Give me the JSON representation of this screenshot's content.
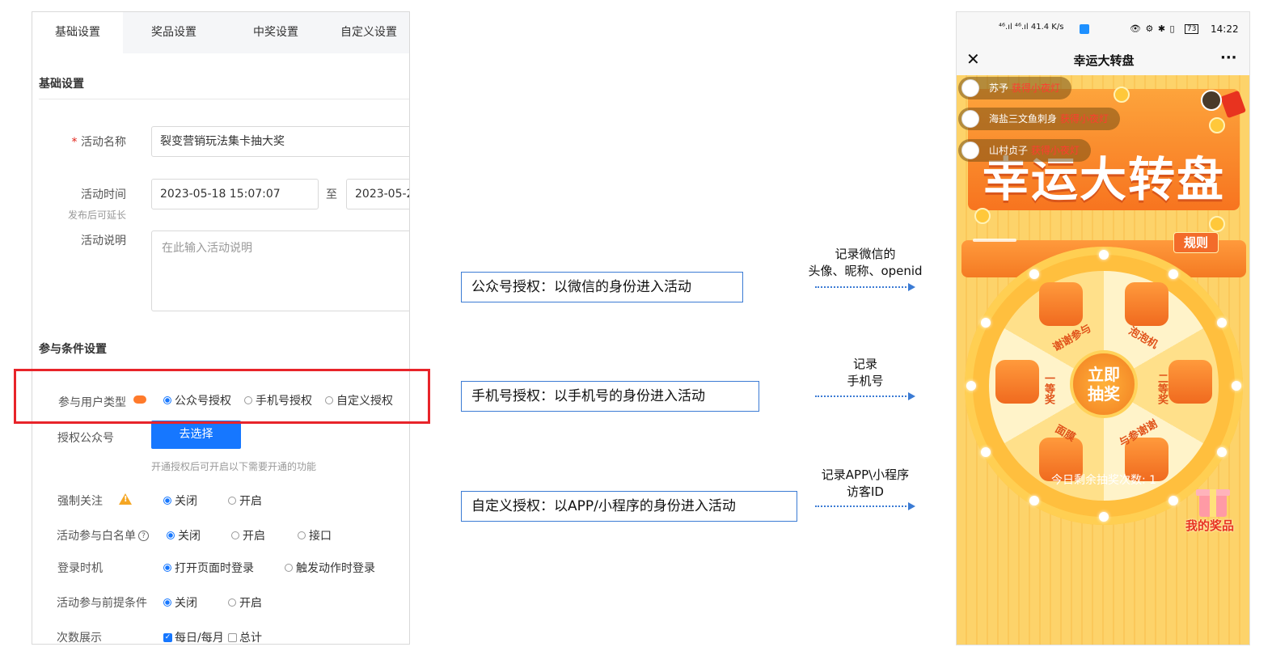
{
  "settings_panel": {
    "tabs": [
      "基础设置",
      "奖品设置",
      "中奖设置",
      "自定义设置"
    ],
    "section_basic": "基础设置",
    "activity_name": {
      "label": "活动名称",
      "required_mark": "*",
      "value": "裂变营销玩法集卡抽大奖"
    },
    "activity_time": {
      "label": "活动时间",
      "hint": "发布后可延长",
      "start": "2023-05-18 15:07:07",
      "separator": "至",
      "end": "2023-05-2"
    },
    "activity_desc": {
      "label": "活动说明",
      "placeholder": "在此输入活动说明"
    },
    "section_conditions": "参与条件设置",
    "user_type": {
      "label": "参与用户类型",
      "options": [
        "公众号授权",
        "手机号授权",
        "自定义授权"
      ],
      "selected": 0
    },
    "auth_account": {
      "label": "授权公众号",
      "button": "去选择",
      "hint": "开通授权后可开启以下需要开通的功能"
    },
    "force_follow": {
      "label": "强制关注",
      "options": [
        "关闭",
        "开启"
      ],
      "selected": 0
    },
    "whitelist": {
      "label": "活动参与白名单",
      "help_icon": "question-icon",
      "options": [
        "关闭",
        "开启",
        "接口"
      ],
      "selected": 0
    },
    "login_time": {
      "label": "登录时机",
      "options": [
        "打开页面时登录",
        "触发动作时登录"
      ],
      "selected": 0
    },
    "precondition": {
      "label": "活动参与前提条件",
      "options": [
        "关闭",
        "开启"
      ],
      "selected": 0
    },
    "count_display": {
      "label": "次数展示",
      "options": [
        "每日/每月",
        "总计"
      ],
      "checked": [
        true,
        false
      ]
    }
  },
  "annotations": [
    {
      "box": "公众号授权：以微信的身份进入活动",
      "note_line1": "记录微信的",
      "note_line2": "头像、昵称、openid"
    },
    {
      "box": "手机号授权：以手机号的身份进入活动",
      "note_line1": "记录",
      "note_line2": "手机号"
    },
    {
      "box": "自定义授权：以APP/小程序的身份进入活动",
      "note_line1": "记录APP\\小程序",
      "note_line2": "访客ID"
    }
  ],
  "phone": {
    "status_left": "⁴⁶.ıl ⁴⁶.ıl 41.4 K/s",
    "status_right": "73",
    "time": "14:22",
    "nav_title": "幸运大转盘",
    "close_icon": "close-icon",
    "more": "···",
    "tickers": [
      {
        "name": "苏予",
        "action": "获得小夜灯"
      },
      {
        "name": "海盐三文鱼刺身",
        "action": "获得小夜灯"
      },
      {
        "name": "山村贞子",
        "action": "获得小夜灯"
      }
    ],
    "banner_title": "幸运大转盘",
    "rules": "规则",
    "prizes": [
      "谢谢参与",
      "泡泡机",
      "二等奖",
      "与参谢谢",
      "面膜",
      "一等奖"
    ],
    "center_button": [
      "立即",
      "抽奖"
    ],
    "remaining": "今日剩余抽奖次数: 1",
    "my_prizes": "我的奖品"
  },
  "colors": {
    "accent_blue": "#1677ff",
    "highlight_red": "#e8242a",
    "orange": "#f47a23",
    "yellow": "#fdd36a"
  }
}
